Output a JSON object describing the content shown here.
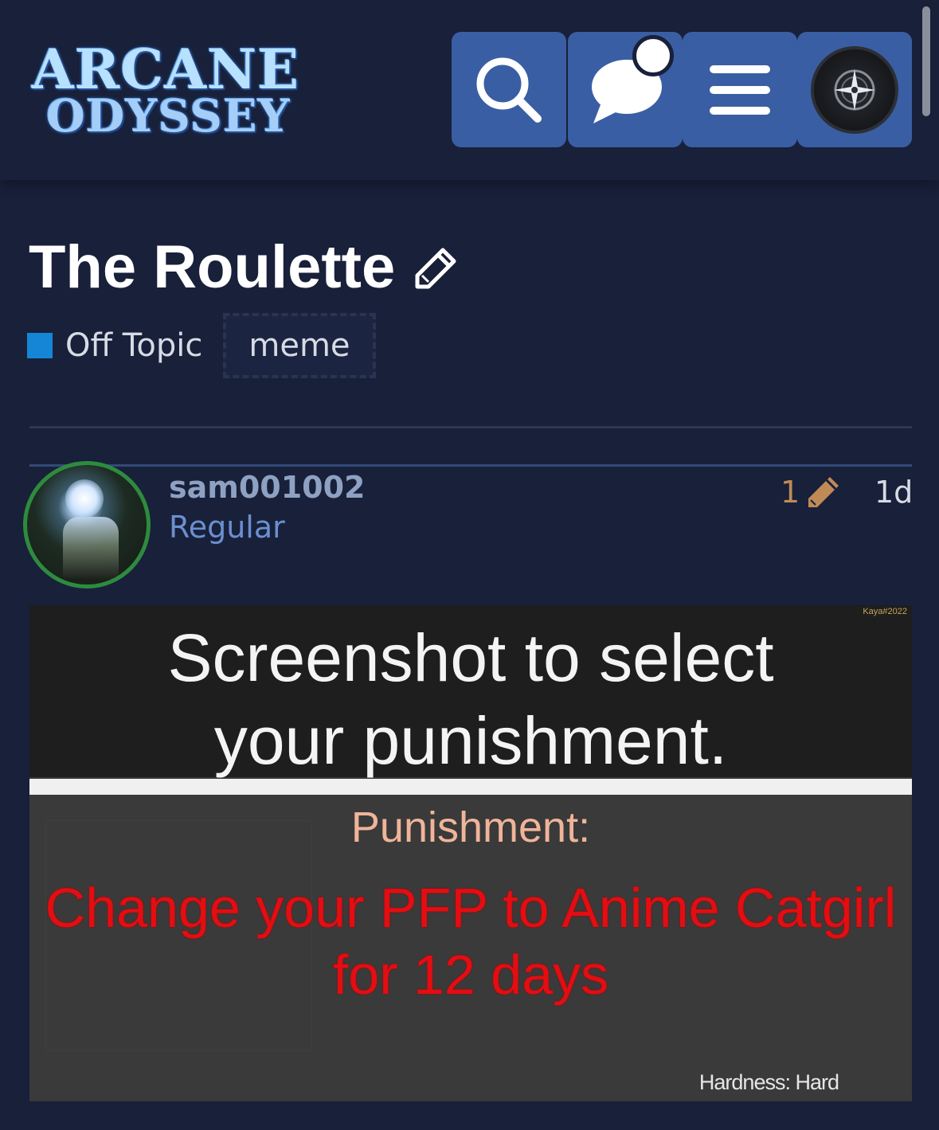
{
  "header": {
    "logo_line1": "ARCANE",
    "logo_line2": "ODYSSEY",
    "buttons": [
      "search-icon",
      "chat-icon",
      "hamburger-menu-icon",
      "user-avatar"
    ],
    "accent_color": "#3a5ea3"
  },
  "topic": {
    "title": "The Roulette",
    "category": "Off Topic",
    "category_color": "#1586d6",
    "tag": "meme"
  },
  "post": {
    "username": "sam001002",
    "user_title": "Regular",
    "edit_count": "1",
    "age": "1d",
    "image": {
      "watermark": "Kaya#2022",
      "headline_line1": "Screenshot to select",
      "headline_line2": "your punishment.",
      "punishment_label": "Punishment:",
      "punishment_line1": "Change your PFP to Anime Catgirl",
      "punishment_line2": "for 12 days",
      "hardness": "Hardness: Hard"
    }
  }
}
